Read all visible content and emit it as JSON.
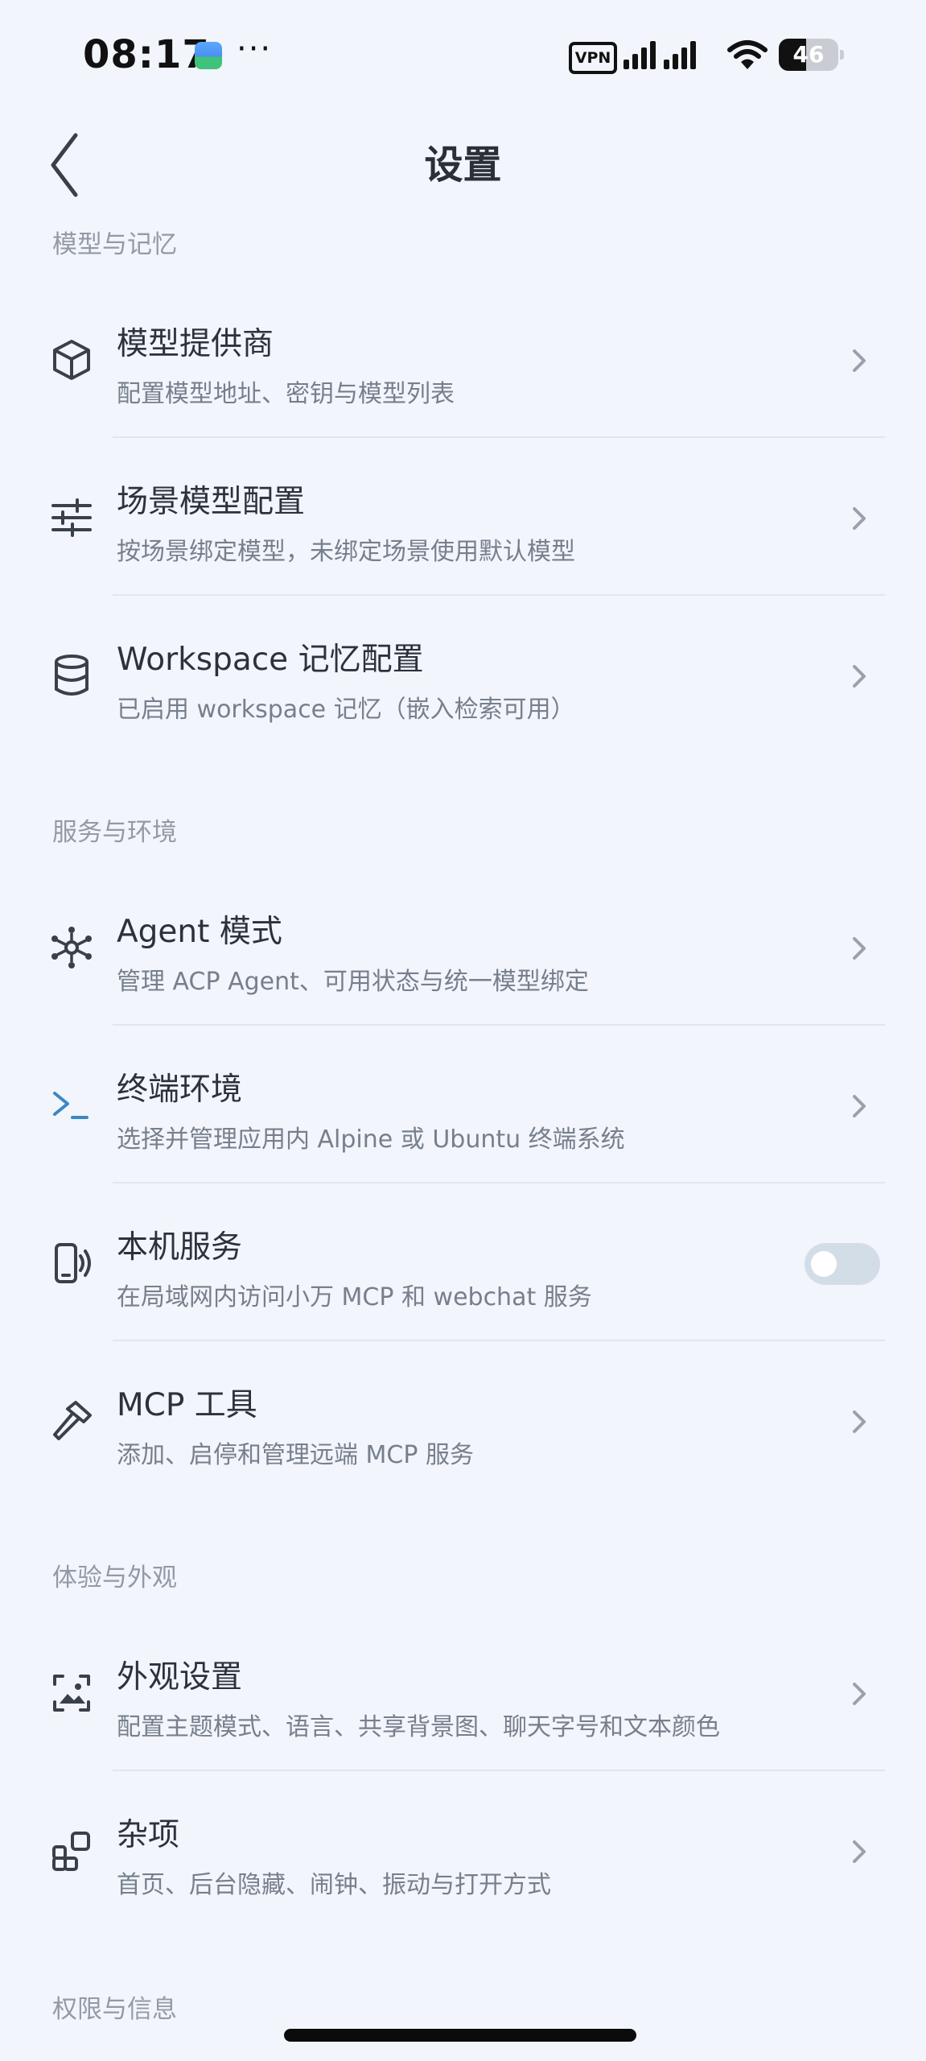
{
  "status_bar": {
    "time": "08:17",
    "more": "···",
    "vpn": "VPN",
    "battery_level": "46",
    "battery_fraction": 0.46
  },
  "header": {
    "title": "设置"
  },
  "sections": [
    {
      "title": "模型与记忆",
      "items": [
        {
          "title": "模型提供商",
          "subtitle": "配置模型地址、密钥与模型列表",
          "icon": "cube-icon"
        },
        {
          "title": "场景模型配置",
          "subtitle": "按场景绑定模型，未绑定场景使用默认模型",
          "icon": "sliders-icon"
        },
        {
          "title": "Workspace 记忆配置",
          "subtitle": "已启用 workspace 记忆（嵌入检索可用）",
          "icon": "database-icon"
        }
      ]
    },
    {
      "title": "服务与环境",
      "items": [
        {
          "title": "Agent 模式",
          "subtitle": "管理 ACP Agent、可用状态与统一模型绑定",
          "icon": "network-hub-icon"
        },
        {
          "title": "终端环境",
          "subtitle": "选择并管理应用内 Alpine 或 Ubuntu 终端系统",
          "icon": "terminal-icon"
        },
        {
          "title": "本机服务",
          "subtitle": "在局域网内访问小万 MCP 和 webchat 服务",
          "icon": "phone-broadcast-icon",
          "toggle_on": false
        },
        {
          "title": "MCP 工具",
          "subtitle": "添加、启停和管理远端 MCP 服务",
          "icon": "hammer-icon"
        }
      ]
    },
    {
      "title": "体验与外观",
      "items": [
        {
          "title": "外观设置",
          "subtitle": "配置主题模式、语言、共享背景图、聊天字号和文本颜色",
          "icon": "image-frame-icon"
        },
        {
          "title": "杂项",
          "subtitle": "首页、后台隐藏、闹钟、振动与打开方式",
          "icon": "widgets-icon"
        }
      ]
    },
    {
      "title": "权限与信息",
      "items": []
    }
  ]
}
